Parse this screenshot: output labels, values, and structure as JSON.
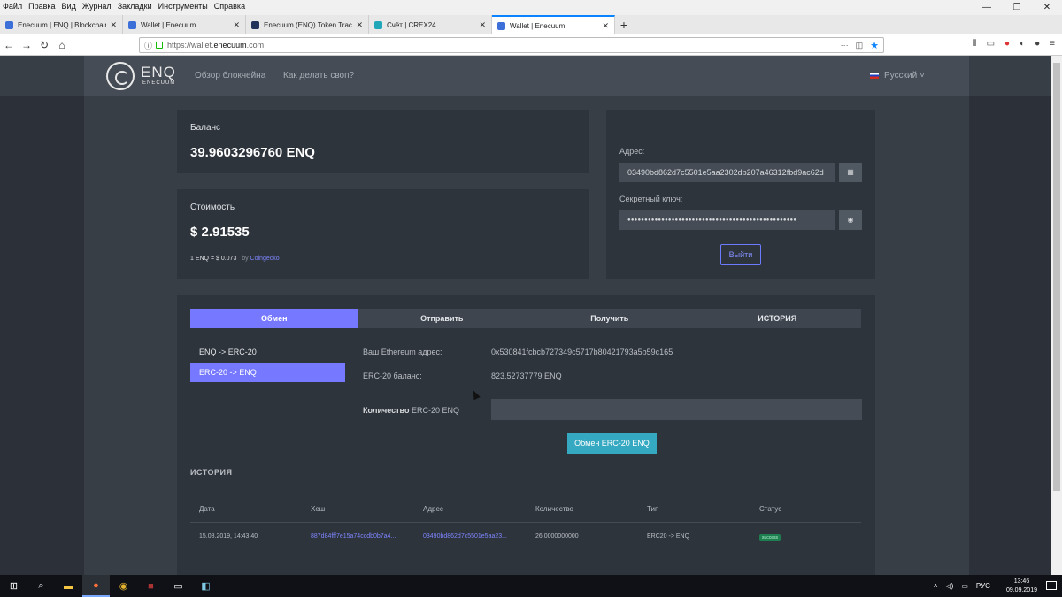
{
  "menubar": [
    "Файл",
    "Правка",
    "Вид",
    "Журнал",
    "Закладки",
    "Инструменты",
    "Справка"
  ],
  "window_controls": [
    "—",
    "❐",
    "✕"
  ],
  "browser_tabs": [
    {
      "title": "Enecuum | ENQ | Blockchain of",
      "color": "#3c6fd8"
    },
    {
      "title": "Wallet | Enecuum",
      "color": "#3c6fd8"
    },
    {
      "title": "Enecuum (ENQ) Token Tracker",
      "color": "#21325b"
    },
    {
      "title": "Счёт | CREX24",
      "color": "#21a8b8"
    },
    {
      "title": "Wallet | Enecuum",
      "color": "#3c6fd8",
      "active": true
    }
  ],
  "address_bar": {
    "prefix": "https://wallet.",
    "domain": "enecuum.com",
    "rest": ".com"
  },
  "header": {
    "logo_text": "ENQ",
    "logo_sub": "ENECUUM",
    "nav": [
      "Обзор блокчейна",
      "Как делать своп?"
    ],
    "language": "Русский"
  },
  "balance": {
    "label": "Баланс",
    "value": "39.9603296760 ENQ"
  },
  "cost": {
    "label": "Стоимость",
    "value": "$ 2.91535",
    "rate": "1 ENQ = $ 0.073",
    "by": "by",
    "source": "Coingecko"
  },
  "account": {
    "address_label": "Адрес:",
    "address": "03490bd862d7c5501e5aa2302db207a46312fbd9ac62d",
    "secret_label": "Секретный ключ:",
    "secret": "●●●●●●●●●●●●●●●●●●●●●●●●●●●●●●●●●●●●●●●●●●●●●●●●●●",
    "logout": "Выйти"
  },
  "tabs": [
    "Обмен",
    "Отправить",
    "Получить",
    "ИСТОРИЯ"
  ],
  "swap_options": [
    "ENQ -> ERC-20",
    "ERC-20 -> ENQ"
  ],
  "swap": {
    "eth_label": "Ваш Ethereum адрес:",
    "eth_address": "0x530841fcbcb727349c5717b80421793a5b59c165",
    "erc_balance_label": "ERC-20 баланс:",
    "erc_balance": "823.52737779 ENQ",
    "amount_label_bold": "Количество",
    "amount_label_rest": "ERC-20 ENQ",
    "amount_value": "",
    "submit": "Обмен ERC-20 ENQ"
  },
  "history": {
    "title": "ИСТОРИЯ",
    "columns": [
      "Дата",
      "Хеш",
      "Адрес",
      "Количество",
      "Тип",
      "Статус"
    ],
    "rows": [
      {
        "date": "15.08.2019, 14:43:40",
        "hash": "887d84fff7e15a74ccdb0b7a4...",
        "address": "03490bd862d7c5501e5aa23...",
        "amount": "26.0000000000",
        "type": "ERC20 -> ENQ",
        "status": "success"
      }
    ]
  },
  "taskbar": {
    "lang": "РУС",
    "time": "13:46",
    "date": "09.09.2019"
  },
  "colors": {
    "accent": "#7679ff",
    "swap_button": "#36a9c2",
    "link": "#7d86ff",
    "panel": "#2e343c",
    "background": "#383e46"
  }
}
